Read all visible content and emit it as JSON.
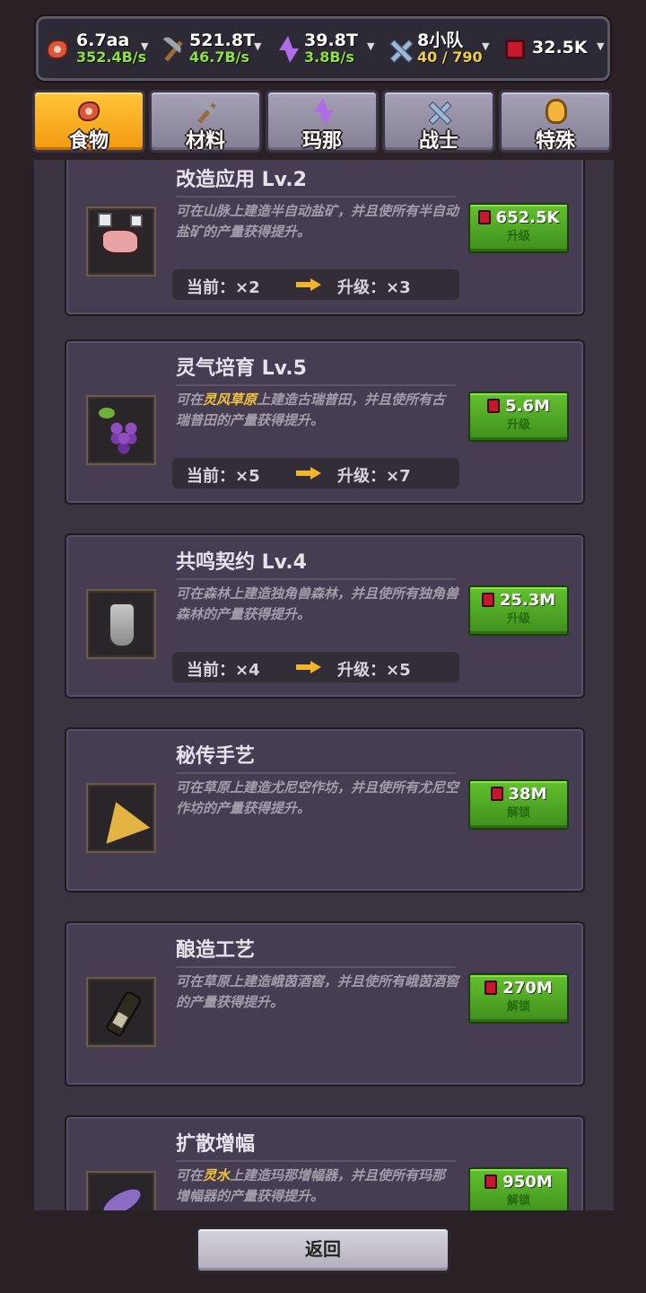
{
  "resources": [
    {
      "icon": "meat-icon",
      "value": "6.7aa",
      "rate": "352.4B/s"
    },
    {
      "icon": "pickaxe-icon",
      "value": "521.8T",
      "rate": "46.7B/s"
    },
    {
      "icon": "lightning-icon",
      "value": "39.8T",
      "rate": "3.8B/s"
    },
    {
      "icon": "crossed-swords-icon",
      "value": "8小队",
      "rate": "40 / 790"
    },
    {
      "icon": "ruby-icon",
      "value": "32.5K"
    }
  ],
  "tabs": [
    {
      "label": "食物",
      "icon": "meat-icon",
      "active": true
    },
    {
      "label": "材料",
      "icon": "pickaxe-icon",
      "active": false
    },
    {
      "label": "玛那",
      "icon": "lightning-icon",
      "active": false
    },
    {
      "label": "战士",
      "icon": "crossed-swords-icon",
      "active": false
    },
    {
      "label": "特殊",
      "icon": "topaz-icon",
      "active": false
    }
  ],
  "cards": [
    {
      "title": "改造应用 Lv.2",
      "icon": "salt-icon",
      "desc": "可在山脉上建造半自动盐矿，并且使所有半自动盐矿的产量获得提升。",
      "cost": "652.5K",
      "action": "升级",
      "current": "当前：×2",
      "next": "升级：×3"
    },
    {
      "title": "灵气培育 Lv.5",
      "icon": "grape-icon",
      "desc_a": "可在",
      "desc_hl": "灵风草原",
      "desc_b": "上建造古瑞普田，并且使所有古瑞普田的产量获得提升。",
      "cost": "5.6M",
      "action": "升级",
      "current": "当前：×5",
      "next": "升级：×7"
    },
    {
      "title": "共鸣契约 Lv.4",
      "icon": "jug-icon",
      "desc": "可在森林上建造独角兽森林，并且使所有独角兽森林的产量获得提升。",
      "cost": "25.3M",
      "action": "升级",
      "current": "当前：×4",
      "next": "升级：×5"
    },
    {
      "title": "秘传手艺",
      "icon": "cheese-icon",
      "desc": "可在草原上建造尤尼空作坊，并且使所有尤尼空作坊的产量获得提升。",
      "cost": "38M",
      "action": "解锁"
    },
    {
      "title": "酿造工艺",
      "icon": "wine-bottle-icon",
      "desc": "可在草原上建造峨茵酒窖，并且使所有峨茵酒窖的产量获得提升。",
      "cost": "270M",
      "action": "解锁"
    },
    {
      "title": "扩散增幅",
      "icon": "fish-icon",
      "desc_a": "可在",
      "desc_hl": "灵水",
      "desc_b": "上建造玛那增幅器，并且使所有玛那增幅器的产量获得提升。",
      "cost": "950M",
      "action": "解锁"
    }
  ],
  "back_label": "返回",
  "colors": {
    "accent": "#f2a016",
    "rate_green": "#8ee23e",
    "rate_yellow": "#f2d044",
    "button_green": "#4fa824",
    "highlight": "#f3c23b"
  }
}
